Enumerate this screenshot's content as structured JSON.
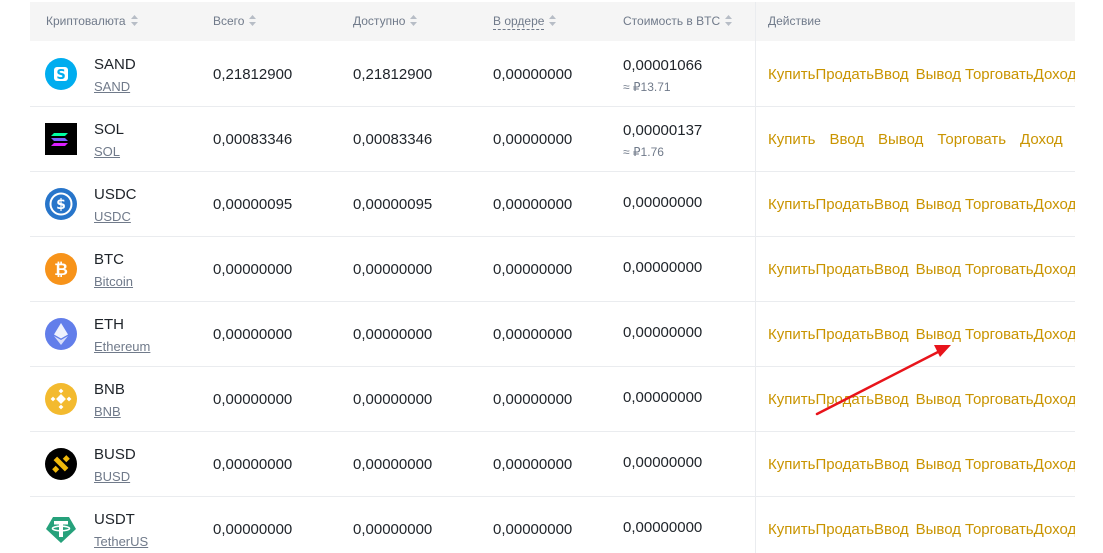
{
  "headers": {
    "coin": "Криптовалюта",
    "total": "Всего",
    "available": "Доступно",
    "in_order": "В ордере",
    "btc_value": "Стоимость в BTC",
    "action": "Действие"
  },
  "rows": [
    {
      "symbol": "SAND",
      "name": "SAND",
      "total": "0,21812900",
      "available": "0,21812900",
      "in_order": "0,00000000",
      "btc": "0,00001066",
      "rub": "≈ ₽13.71",
      "icon": "sand-icon",
      "color": "#00adef"
    },
    {
      "symbol": "SOL",
      "name": "SOL",
      "total": "0,00083346",
      "available": "0,00083346",
      "in_order": "0,00000000",
      "btc": "0,00000137",
      "rub": "≈ ₽1.76",
      "icon": "sol-icon",
      "color": "#000000"
    },
    {
      "symbol": "USDC",
      "name": "USDC",
      "total": "0,00000095",
      "available": "0,00000095",
      "in_order": "0,00000000",
      "btc": "0,00000000",
      "icon": "usdc-icon",
      "color": "#2775ca"
    },
    {
      "symbol": "BTC",
      "name": "Bitcoin",
      "total": "0,00000000",
      "available": "0,00000000",
      "in_order": "0,00000000",
      "btc": "0,00000000",
      "icon": "btc-icon",
      "color": "#f7931a"
    },
    {
      "symbol": "ETH",
      "name": "Ethereum",
      "total": "0,00000000",
      "available": "0,00000000",
      "in_order": "0,00000000",
      "btc": "0,00000000",
      "icon": "eth-icon",
      "color": "#627eea"
    },
    {
      "symbol": "BNB",
      "name": "BNB",
      "total": "0,00000000",
      "available": "0,00000000",
      "in_order": "0,00000000",
      "btc": "0,00000000",
      "icon": "bnb-icon",
      "color": "#f3ba2f"
    },
    {
      "symbol": "BUSD",
      "name": "BUSD",
      "total": "0,00000000",
      "available": "0,00000000",
      "in_order": "0,00000000",
      "btc": "0,00000000",
      "icon": "busd-icon",
      "color": "#000000"
    },
    {
      "symbol": "USDT",
      "name": "TetherUS",
      "total": "0,00000000",
      "available": "0,00000000",
      "in_order": "0,00000000",
      "btc": "0,00000000",
      "icon": "usdt-icon",
      "color": "#26a17b"
    }
  ],
  "actions_default": [
    "Купить",
    "Продать",
    "Ввод",
    "Вывод",
    "Торговать",
    "Доход"
  ],
  "actions_sol": [
    "Купить",
    "Ввод",
    "Вывод",
    "Торговать",
    "Доход"
  ],
  "colors": {
    "accent": "#c99400",
    "arrow": "#e8141b"
  }
}
